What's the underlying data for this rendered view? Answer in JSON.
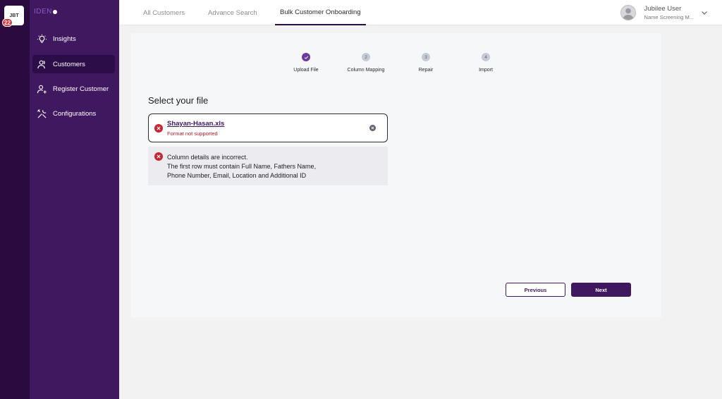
{
  "org": {
    "code": "JBT",
    "badge": "22"
  },
  "sidebar": {
    "logo_text": "IDEN",
    "items": [
      {
        "label": "Insights",
        "icon": "lightbulb-icon",
        "active": false
      },
      {
        "label": "Customers",
        "icon": "users-icon",
        "active": true
      },
      {
        "label": "Register Customer",
        "icon": "add-user-icon",
        "active": false
      },
      {
        "label": "Configurations",
        "icon": "tools-icon",
        "active": false
      }
    ]
  },
  "header": {
    "tabs": [
      {
        "label": "All Customers",
        "active": false
      },
      {
        "label": "Advance Search",
        "active": false
      },
      {
        "label": "Bulk Customer Onboarding",
        "active": true
      }
    ],
    "user": {
      "name": "Jubilee User",
      "role": "Name Screening M..."
    }
  },
  "stepper": {
    "steps": [
      {
        "number": "✓",
        "label": "Upload File",
        "done": true
      },
      {
        "number": "2",
        "label": "Column Mapping",
        "done": false
      },
      {
        "number": "3",
        "label": "Repair",
        "done": false
      },
      {
        "number": "4",
        "label": "Import",
        "done": false
      }
    ]
  },
  "upload": {
    "title": "Select your file",
    "file_name": "Shayan-Hasan.xls",
    "file_status": "Format not supported",
    "error_lines": [
      "Column details are incorrect.",
      "The first row must contain Full Name, Fathers Name,",
      "Phone Number, Email, Location and Additional ID"
    ]
  },
  "actions": {
    "previous_label": "Previous",
    "next_label": "Next"
  },
  "colors": {
    "brand": "#3f1860",
    "rail": "#2a0a3f",
    "error": "#c8232f",
    "step_done": "#6b3a9e"
  }
}
